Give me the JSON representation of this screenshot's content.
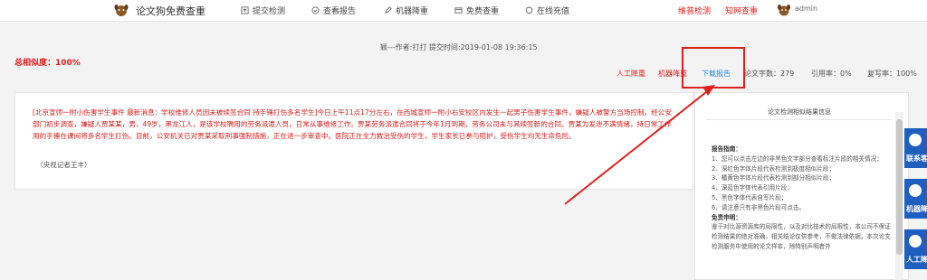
{
  "header": {
    "brand": "论文狗免费查重",
    "nav": [
      {
        "label": "提交检测",
        "icon": "upload-icon"
      },
      {
        "label": "查看报告",
        "icon": "report-icon"
      },
      {
        "label": "机器降重",
        "icon": "pen-icon"
      },
      {
        "label": "免费查重",
        "icon": "free-icon"
      },
      {
        "label": "在线充值",
        "icon": "shield-icon"
      }
    ],
    "links": [
      "维普检测",
      "知网查重"
    ],
    "username": "admin"
  },
  "report": {
    "meta": "颖---作者:打打  提交时间:2019-01-08 19:36:15",
    "total_similarity": "总相似度：100%",
    "actions": {
      "manual": "人工降重",
      "machine": "机器降重",
      "download": "下载报告"
    },
    "stats": {
      "words": "论文字数：279",
      "quote": "引用率：0%",
      "copy": "复写率：100%"
    }
  },
  "content": {
    "text": "[北京宣师一附小伤害学生事件 最新消息：学校维修人员因未被续签合同 持手锤打伤多名学生]今日上午11点17分左右，在西城宣师一附小右安校区内发生一起男子伤害学生事件，嫌疑人被警方当场控制。经公安部门初步调查，嫌疑人贾某某，男，49岁，黑龙江人，是该学校聘用的劳务派遣人员，日常从事维修工作。贾某劳务派遣合同将于今年1月到期，劳务公司未与其续签新的合同。贾某为发泄不满情绪，持日常工作用的手锤在课间将多名学生打伤。目前，公安机关已对贾某采取刑事强制措施，正在进一步审查中。医院正在全力救治受伤的学生，学生家长已参与陪护，受伤学生均无生命危险。",
    "source": "（央视记者王丰）"
  },
  "sidebar": {
    "title": "论文检测相似结果信息",
    "guide_title": "报告指南：",
    "guide_items": [
      "1、您可以点击左边的非黑色文字部分查看标注片段的相关情况；",
      "2、深红色字体片段代表检测到极度相似片段；",
      "3、橘黄色字体片段代表检测到部分相似片段；",
      "4、深蓝色字体代表引用片段；",
      "5、黑色字体代表自写片段；",
      "6、请注意只有非黑色片段可点击。"
    ],
    "disclaimer_title": "免责申明：",
    "disclaimer": "鉴于对比源资源库的局限性，以及对比技术的局限性，本公司不保证检测结果的绝对准确，相关结论仅供参考，不做法律依据。本次论文检测服务中使用的论文样本，除特别声明者外"
  },
  "float": [
    "联系客",
    "机器降",
    "人工降"
  ],
  "colors": {
    "accent": "#e02020",
    "link": "#1e88e5",
    "float": "#1f5fbf"
  }
}
